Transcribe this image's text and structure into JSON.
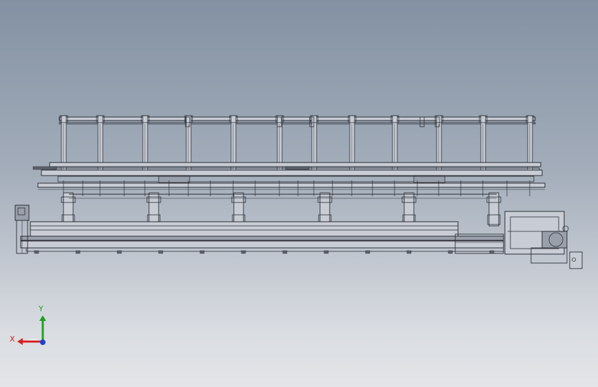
{
  "viewport": {
    "background_top": "#8391a2",
    "background_bottom": "#e3e5e8",
    "line_color": "#2a2d33",
    "fill_light": "#c8ccd4",
    "fill_mid": "#9aa0ab",
    "fill_dark": "#5d626c"
  },
  "triad": {
    "x_label": "X",
    "y_label": "Y",
    "x_color": "#d42020",
    "y_color": "#20a020",
    "z_color": "#2040d0"
  }
}
